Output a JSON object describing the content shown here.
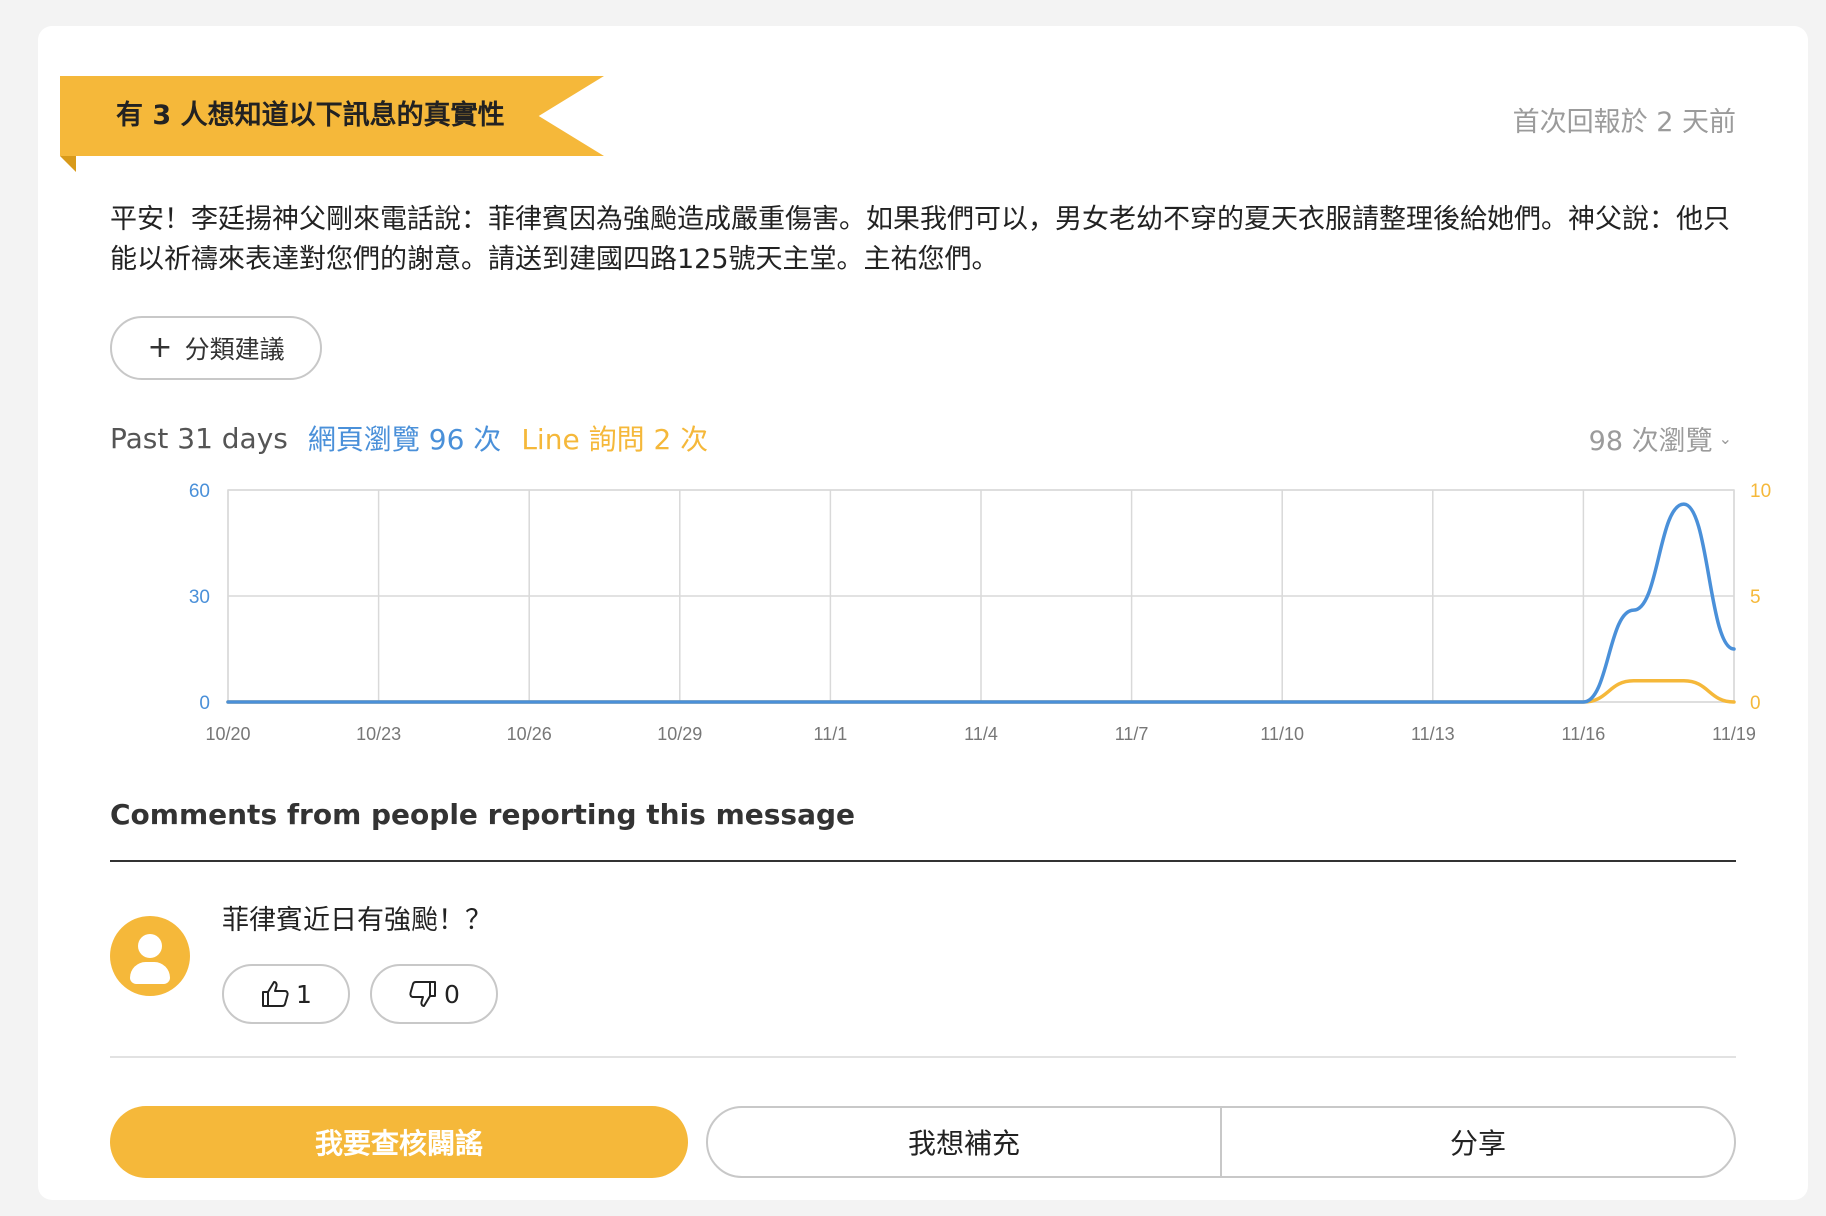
{
  "banner": {
    "ribbon_text": "有 3 人想知道以下訊息的真實性",
    "first_reported": "首次回報於 2 天前"
  },
  "message": {
    "text": "平安！李廷揚神父剛來電話說：菲律賓因為強颱造成嚴重傷害。如果我們可以，男女老幼不穿的夏天衣服請整理後給她們。神父說：他只能以祈禱來表達對您們的謝意。請送到建國四路125號天主堂。主祐您們。"
  },
  "category_button": {
    "icon": "plus-icon",
    "label": "分類建議"
  },
  "stats": {
    "period_label": "Past 31 days",
    "web_views_label": "網頁瀏覽 96 次",
    "line_queries_label": "Line 詢問 2 次",
    "total_views_label": "98 次瀏覽",
    "colors": {
      "web": "#4a90d9",
      "line": "#f5b83a"
    }
  },
  "chart_data": {
    "type": "line",
    "x": [
      "10/20",
      "10/21",
      "10/22",
      "10/23",
      "10/24",
      "10/25",
      "10/26",
      "10/27",
      "10/28",
      "10/29",
      "10/30",
      "10/31",
      "11/1",
      "11/2",
      "11/3",
      "11/4",
      "11/5",
      "11/6",
      "11/7",
      "11/8",
      "11/9",
      "11/10",
      "11/11",
      "11/12",
      "11/13",
      "11/14",
      "11/15",
      "11/16",
      "11/17",
      "11/18",
      "11/19"
    ],
    "x_tick_labels": [
      "10/20",
      "10/23",
      "10/26",
      "10/29",
      "11/1",
      "11/4",
      "11/7",
      "11/10",
      "11/13",
      "11/16",
      "11/19"
    ],
    "series": [
      {
        "axis": "left",
        "color": "#4a90d9",
        "values": [
          0,
          0,
          0,
          0,
          0,
          0,
          0,
          0,
          0,
          0,
          0,
          0,
          0,
          0,
          0,
          0,
          0,
          0,
          0,
          0,
          0,
          0,
          0,
          0,
          0,
          0,
          0,
          0,
          26,
          56,
          15
        ]
      },
      {
        "axis": "right",
        "color": "#f5b83a",
        "values": [
          0,
          0,
          0,
          0,
          0,
          0,
          0,
          0,
          0,
          0,
          0,
          0,
          0,
          0,
          0,
          0,
          0,
          0,
          0,
          0,
          0,
          0,
          0,
          0,
          0,
          0,
          0,
          0,
          1,
          1,
          0
        ]
      }
    ],
    "y_left": {
      "ticks": [
        "60",
        "30",
        "0"
      ],
      "ylim": [
        0,
        60
      ],
      "color": "#4a90d9"
    },
    "y_right": {
      "ticks": [
        "10",
        "5",
        "0"
      ],
      "ylim": [
        0,
        10
      ],
      "color": "#f5b83a"
    },
    "grid": true
  },
  "comments": {
    "title": "Comments from people reporting this message",
    "items": [
      {
        "text": "菲律賓近日有強颱！？",
        "likes": "1",
        "dislikes": "0"
      }
    ]
  },
  "actions": {
    "primary": "我要查核闢謠",
    "add_info": "我想補充",
    "share": "分享"
  }
}
